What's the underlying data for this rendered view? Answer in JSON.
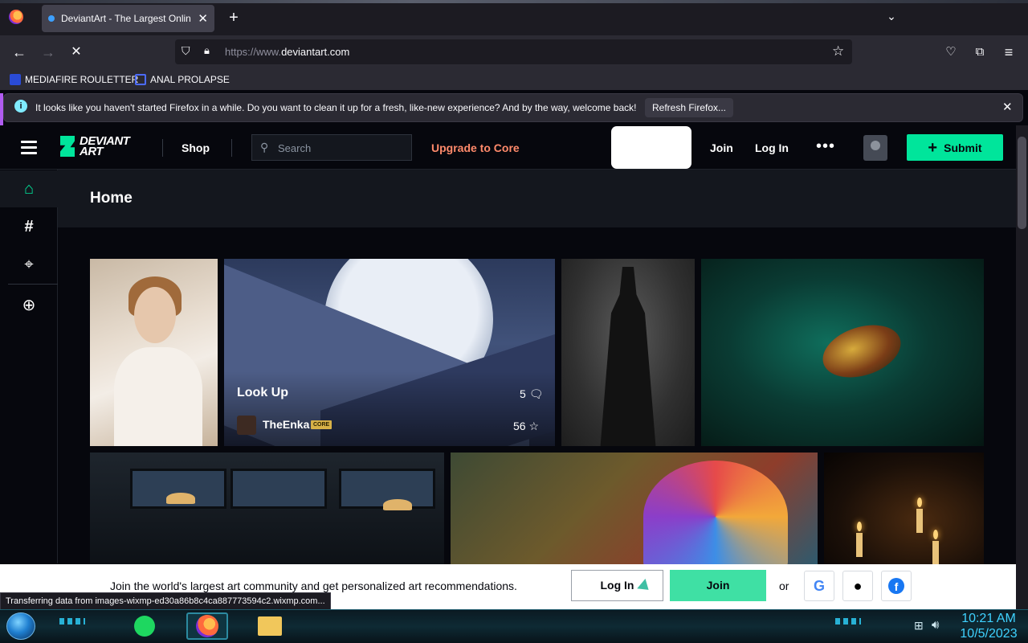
{
  "browser": {
    "tab_title": "DeviantArt - The Largest Online",
    "url_prefix": "https://www.",
    "url_host": "deviantart.com",
    "bookmarks": [
      "MEDIAFIRE ROULETTER",
      "ANAL PROLAPSE"
    ],
    "notice_text": "It looks like you haven't started Firefox in a while. Do you want to clean it up for a fresh, like-new experience? And by the way, welcome back!",
    "notice_button": "Refresh Firefox...",
    "status_text": "Transferring data from images-wixmp-ed30a86b8c4ca887773594c2.wixmp.com..."
  },
  "header": {
    "logo_line1": "DEVIANT",
    "logo_line2": "ART",
    "shop": "Shop",
    "search_placeholder": "Search",
    "upgrade": "Upgrade to Core",
    "join": "Join",
    "login": "Log In",
    "more": "•••",
    "submit": "Submit"
  },
  "sidebar": {
    "icons": [
      "home-icon",
      "hashtag-icon",
      "telescope-icon",
      "plus-circle-icon"
    ]
  },
  "main": {
    "title": "Home",
    "featured": {
      "title": "Look Up",
      "comments": "5",
      "author": "TheEnka",
      "badge": "CORE",
      "favourites": "56"
    }
  },
  "join_banner": {
    "text": "Join the world's largest art community and get personalized art recommendations.",
    "login": "Log In",
    "join": "Join",
    "or": "or",
    "social": [
      "google-icon",
      "apple-icon",
      "facebook-icon"
    ]
  },
  "taskbar": {
    "time": "10:21 AM",
    "date": "10/5/2023"
  },
  "colors": {
    "accent": "#00e59b",
    "upgrade": "#ff8a6b",
    "page_bg": "#06070d"
  }
}
